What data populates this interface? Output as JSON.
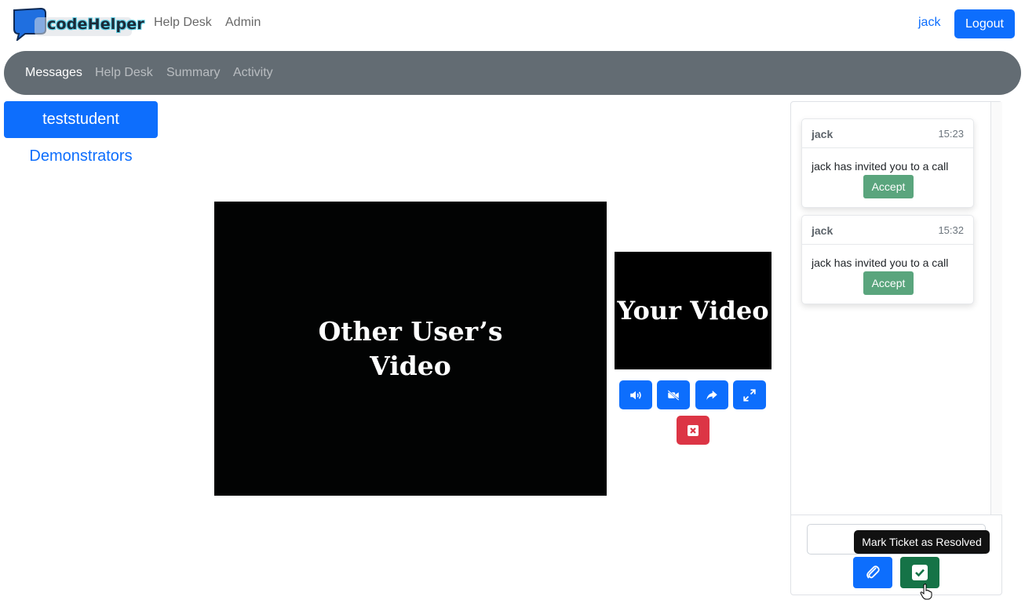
{
  "brand": {
    "name": "codeHelper",
    "logo_color": "#1f6fe0"
  },
  "topnav": {
    "links": [
      "Help Desk",
      "Admin"
    ],
    "user": "jack",
    "logout_label": "Logout"
  },
  "subnav": {
    "tabs": [
      {
        "label": "Messages",
        "active": true
      },
      {
        "label": "Help Desk",
        "active": false
      },
      {
        "label": "Summary",
        "active": false
      },
      {
        "label": "Activity",
        "active": false
      }
    ]
  },
  "sidebar": {
    "active_item": "teststudent",
    "link": "Demonstrators"
  },
  "video": {
    "remote_label": "Other User’s Video",
    "local_label": "Your Video",
    "controls": [
      {
        "icon": "volume-icon",
        "label": "toggle audio"
      },
      {
        "icon": "video-off-icon",
        "label": "toggle video"
      },
      {
        "icon": "share-icon",
        "label": "share screen"
      },
      {
        "icon": "fullscreen-icon",
        "label": "fullscreen"
      }
    ],
    "end_call_icon": "close-icon"
  },
  "chat": {
    "messages": [
      {
        "from": "jack",
        "time": "15:23",
        "text": "jack has invited you to a call",
        "action": "Accept"
      },
      {
        "from": "jack",
        "time": "15:32",
        "text": "jack has invited you to a call",
        "action": "Accept"
      }
    ],
    "input_value": "",
    "tooltip": "Mark Ticket as Resolved",
    "attach_icon": "paperclip-icon",
    "resolve_icon": "check-square-icon"
  },
  "colors": {
    "primary": "#0d6efd",
    "subnav_bg": "#636c73",
    "accept": "#5aa57d",
    "danger": "#dc3545",
    "resolve": "#157347"
  }
}
